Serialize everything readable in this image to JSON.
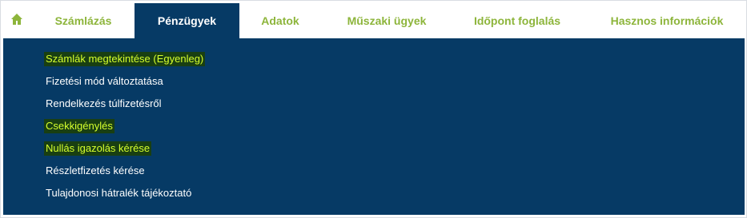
{
  "nav": {
    "home_icon": "home-icon",
    "tabs": [
      {
        "label": "Számlázás",
        "active": false
      },
      {
        "label": "Pénzügyek",
        "active": true
      },
      {
        "label": "Adatok",
        "active": false
      },
      {
        "label": "Műszaki ügyek",
        "active": false
      },
      {
        "label": "Időpont foglalás",
        "active": false
      },
      {
        "label": "Hasznos információk",
        "active": false
      }
    ]
  },
  "dropdown": {
    "items": [
      {
        "label": "Számlák megtekintése (Egyenleg)",
        "highlighted": true
      },
      {
        "label": "Fizetési mód változtatása",
        "highlighted": false
      },
      {
        "label": "Rendelkezés túlfizetésről",
        "highlighted": false
      },
      {
        "label": "Csekkigénylés",
        "highlighted": true
      },
      {
        "label": "Nullás igazolás kérése",
        "highlighted": true
      },
      {
        "label": "Részletfizetés kérése",
        "highlighted": false
      },
      {
        "label": "Tulajdonosi hátralék tájékoztató",
        "highlighted": false
      }
    ]
  },
  "colors": {
    "nav_text": "#8db53b",
    "active_bg": "#063a65",
    "dropdown_bg": "#063a65",
    "highlight_bg": "#193f12",
    "highlight_text": "#d6ff2d"
  }
}
